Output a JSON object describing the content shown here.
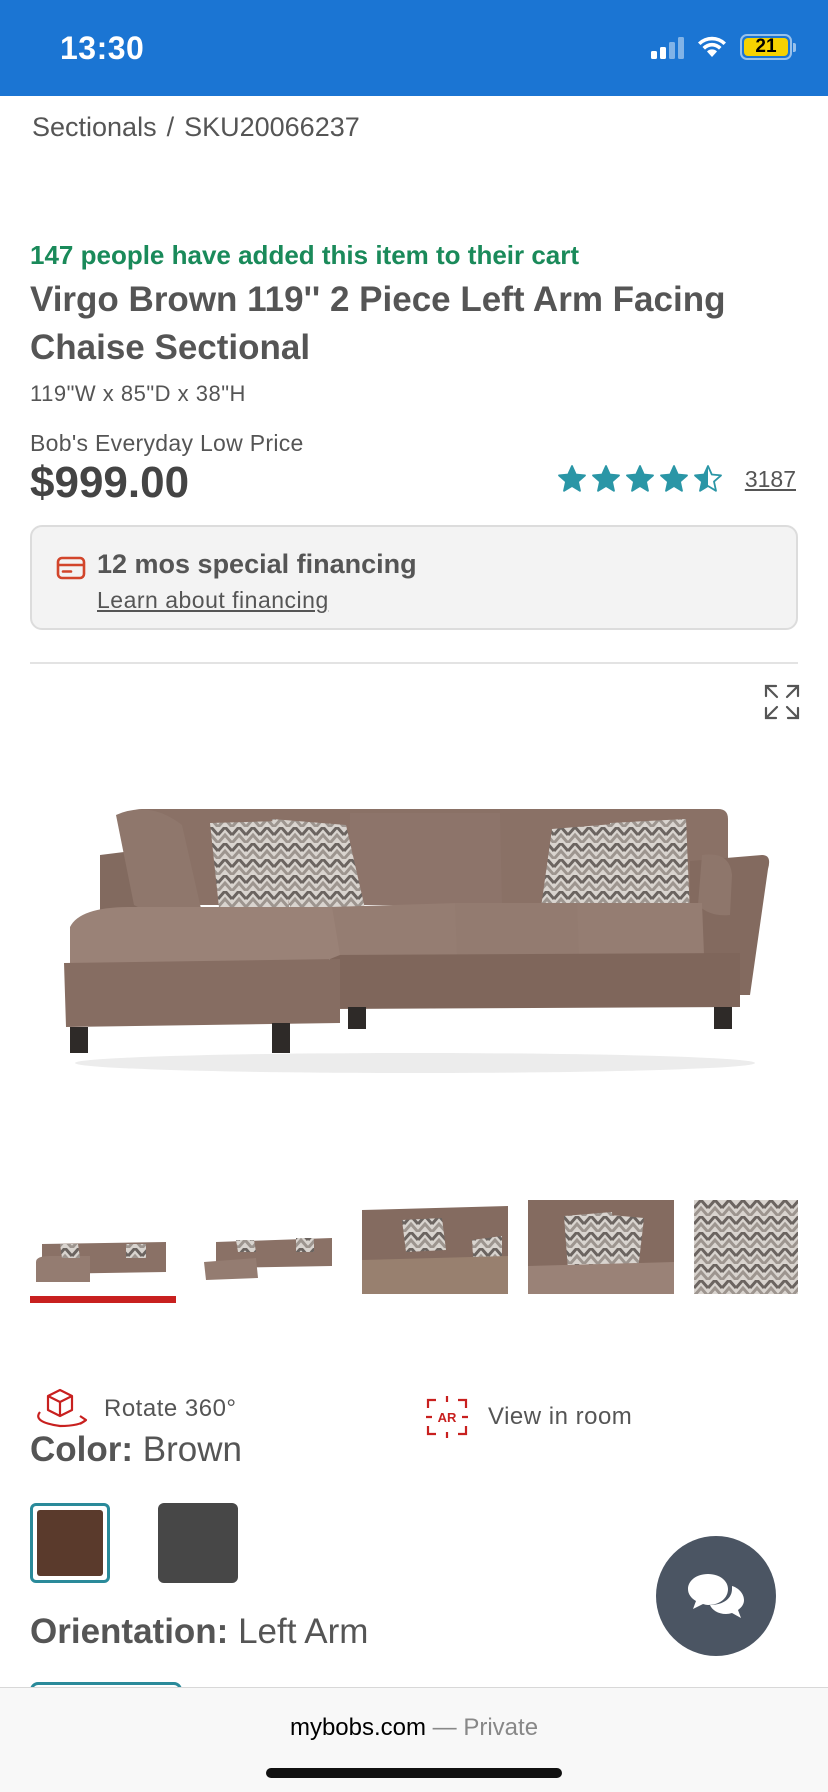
{
  "status_bar": {
    "time": "13:30",
    "battery": "21",
    "background_color": "#1b75d3"
  },
  "breadcrumb": {
    "category": "Sectionals",
    "separator": "/",
    "sku": "SKU20066237"
  },
  "product": {
    "social_proof": "147 people have added this item to their cart",
    "title": "Virgo Brown 119'' 2 Piece Left Arm Facing Chaise Sectional",
    "dimensions": "119\"W x 85\"D x 38\"H",
    "price_label": "Bob's Everyday Low Price",
    "price": "$999.00",
    "rating": 4.5,
    "review_count": "3187",
    "rating_color": "#2a96a6"
  },
  "financing": {
    "title": "12 mos special financing",
    "link_label": "Learn about financing",
    "icon": "credit-card-icon"
  },
  "gallery": {
    "expand_icon": "expand-icon",
    "main_image": "sectional-sofa-photo",
    "thumbnails": [
      {
        "name": "thumb-front-view",
        "active": true
      },
      {
        "name": "thumb-angle-view",
        "active": false
      },
      {
        "name": "thumb-corner-view",
        "active": false
      },
      {
        "name": "thumb-pillows-view",
        "active": false
      },
      {
        "name": "thumb-fabric-view",
        "active": false
      }
    ],
    "active_indicator_color": "#c8201f"
  },
  "actions": {
    "rotate_label": "Rotate 360°",
    "view_in_room_label": "View in room",
    "ar_badge": "AR"
  },
  "options": {
    "color_label": "Color:",
    "color_value": "Brown",
    "swatches": [
      {
        "name": "Brown",
        "hex": "#5a3a2c",
        "selected": true
      },
      {
        "name": "Gray",
        "hex": "#474747",
        "selected": false
      }
    ],
    "orientation_label": "Orientation:",
    "orientation_value": "Left Arm"
  },
  "chat": {
    "icon": "chat-bubbles-icon"
  },
  "browser": {
    "domain": "mybobs.com",
    "separator": "—",
    "mode": "Private"
  }
}
